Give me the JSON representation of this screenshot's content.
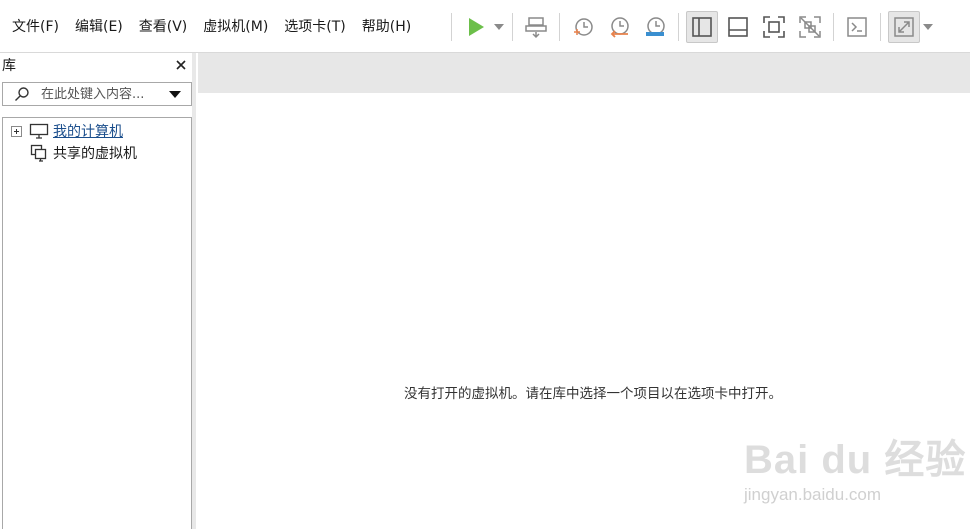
{
  "menu": {
    "items": [
      "文件(F)",
      "编辑(E)",
      "查看(V)",
      "虚拟机(M)",
      "选项卡(T)",
      "帮助(H)"
    ]
  },
  "toolbar": {
    "icons": [
      "play-icon",
      "send-keys-icon",
      "snapshot-take-icon",
      "snapshot-revert-icon",
      "snapshot-manager-icon",
      "library-view-icon",
      "thumbnail-bar-icon",
      "fullscreen-icon",
      "unity-icon",
      "console-icon",
      "stretch-guest-icon"
    ],
    "colors": {
      "play": "#6cbf4a",
      "snapshot_orange": "#e8824c",
      "snapshot_blue": "#3a8fd0"
    }
  },
  "library": {
    "title": "库",
    "search": {
      "placeholder": "在此处键入内容..."
    },
    "tree": [
      {
        "label": "我的计算机",
        "icon": "computer-icon",
        "expandable": true
      },
      {
        "label": "共享的虚拟机",
        "icon": "shared-vm-icon",
        "expandable": false
      }
    ]
  },
  "main": {
    "empty_message": "没有打开的虚拟机。请在库中选择一个项目以在选项卡中打开。"
  },
  "watermark": {
    "text": "Bai du 经验",
    "url": "jingyan.baidu.com"
  }
}
